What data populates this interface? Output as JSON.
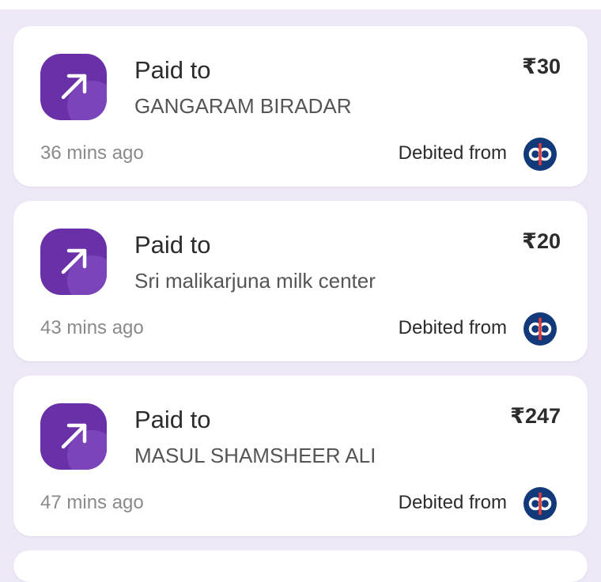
{
  "colors": {
    "page_background": "#ede7f6",
    "card_background": "#ffffff",
    "icon_purple": "#6a30a8",
    "bank_navy": "#123a7a",
    "bank_red": "#e23c3c"
  },
  "transactions": [
    {
      "label": "Paid to",
      "payee": "GANGARAM BIRADAR",
      "amount": "₹30",
      "time": "36 mins ago",
      "debited_label": "Debited from",
      "icon": "arrow-up-right-icon",
      "bank_icon": "bank-logo-icon"
    },
    {
      "label": "Paid to",
      "payee": "Sri malikarjuna milk center",
      "amount": "₹20",
      "time": "43 mins ago",
      "debited_label": "Debited from",
      "icon": "arrow-up-right-icon",
      "bank_icon": "bank-logo-icon"
    },
    {
      "label": "Paid to",
      "payee": "MASUL SHAMSHEER ALI",
      "amount": "₹247",
      "time": "47 mins ago",
      "debited_label": "Debited from",
      "icon": "arrow-up-right-icon",
      "bank_icon": "bank-logo-icon"
    }
  ]
}
